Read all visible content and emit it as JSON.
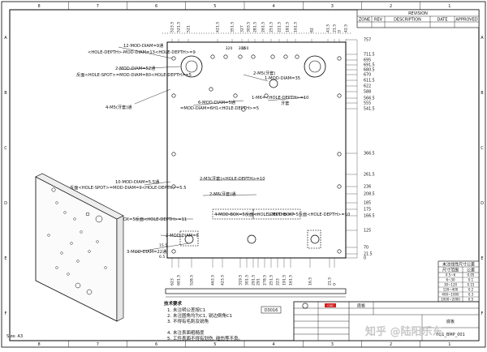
{
  "sheet": {
    "zone_cols": [
      "1",
      "2",
      "3",
      "4",
      "5",
      "6",
      "7",
      "8"
    ],
    "zone_rows": [
      "A",
      "B",
      "C",
      "D",
      "E",
      "F"
    ],
    "size_label": "Size: A3"
  },
  "revision": {
    "title": "REVISION",
    "headers": [
      "ZONE",
      "REV",
      "DESCRIPTION",
      "DATE",
      "APPROVED"
    ]
  },
  "dims_top": [
    "523.5",
    "521.5",
    "521",
    "421.5",
    "351.5",
    "327",
    "303.5",
    "281.5",
    "261.5",
    "251.5",
    "221.5",
    "181.5",
    "161.5",
    "82",
    "41.5",
    "21.5",
    "0",
    "42.5"
  ],
  "dims_top_mid": [
    "320",
    "300",
    "150"
  ],
  "dims_right": [
    "757",
    "711.5",
    "695",
    "691.5",
    "680.5",
    "670",
    "611.5",
    "622",
    "588",
    "566.5",
    "555",
    "541.5",
    "366.5",
    "261.5",
    "236",
    "208.5",
    "185",
    "175",
    "166.5",
    "125",
    "70",
    "21.5",
    "0"
  ],
  "dims_bottom": [
    "623",
    "601.5",
    "528.5",
    "463.5",
    "423.5",
    "319.5",
    "301.5",
    "291.5",
    "291",
    "278.5",
    "251.5",
    "223",
    "191.5",
    "161.5",
    "16.5",
    "21.5",
    "0"
  ],
  "dims_left": [
    "6.5",
    "15.5"
  ],
  "callouts": [
    "12-MOD-DIAM=9通",
    "<HOLE-DEPTH>-MOD-DIAM=13<HOLE-DEPTH>=9",
    "2-MOD-DIAM=52通",
    "反面<HOLE-SPOT>=MOD-DIAM=80<HOLE-DEPTH>=5",
    "4-M5(牙套)通",
    "2-M5(牙套)",
    "1-MOD-DIAM=35",
    "6-MOD-DIAM=5通",
    "=MOD-DIAM=6H1<HOLE-DEPTH>=5",
    "1-M6=<HOLE-DEPTH>=10",
    "牙套",
    "2-M3(牙套)<HOLE-DEPTH>=10",
    "2-M6(牙套)通",
    "10-MOD-DIAM=5.5通",
    "反面<HOLE-SPOT>=MOD-DIAM=9<HOLE-DEPTH>=5.5",
    "MOD-BOX=5反面<HOLE-DEPTH>=11",
    "4-MOD-BOX=5反面<HOLE-DEPTH>=7",
    "1-MOD-BOX=5反面<HOLE-DEPTH>=10",
    "2-MOD-DIAM=6",
    "3-MOD-DIAM=22通"
  ],
  "section_label": "D3016",
  "notes": {
    "title": "技术要求",
    "lines": [
      "1. 未注明公差按C1",
      "2. 未注圆角均为C1, 锐边倒角C1",
      "3. 不得有毛刺及锐角",
      "",
      "4. 未注表面粗糙度",
      "5. 工件表面不得有划伤, 碰伤等不良。"
    ]
  },
  "tolerance_table": {
    "title": "未注线性尺寸公差",
    "headers": [
      "尺寸范围",
      "公差"
    ],
    "rows": [
      [
        "0.5~6",
        "0.05"
      ],
      [
        "6~30",
        "0.1"
      ],
      [
        "30~120",
        "0.15"
      ],
      [
        "120~400",
        "0.2"
      ],
      [
        "400~1000",
        "0.3"
      ],
      [
        "1000~2000",
        "0.5"
      ]
    ]
  },
  "title_block": {
    "part_name": "底板",
    "company_label": "CAD",
    "part_no": "EQ1_BMP_001",
    "drawing_label": "底板"
  },
  "watermark": "知乎 @陆阳乐东"
}
